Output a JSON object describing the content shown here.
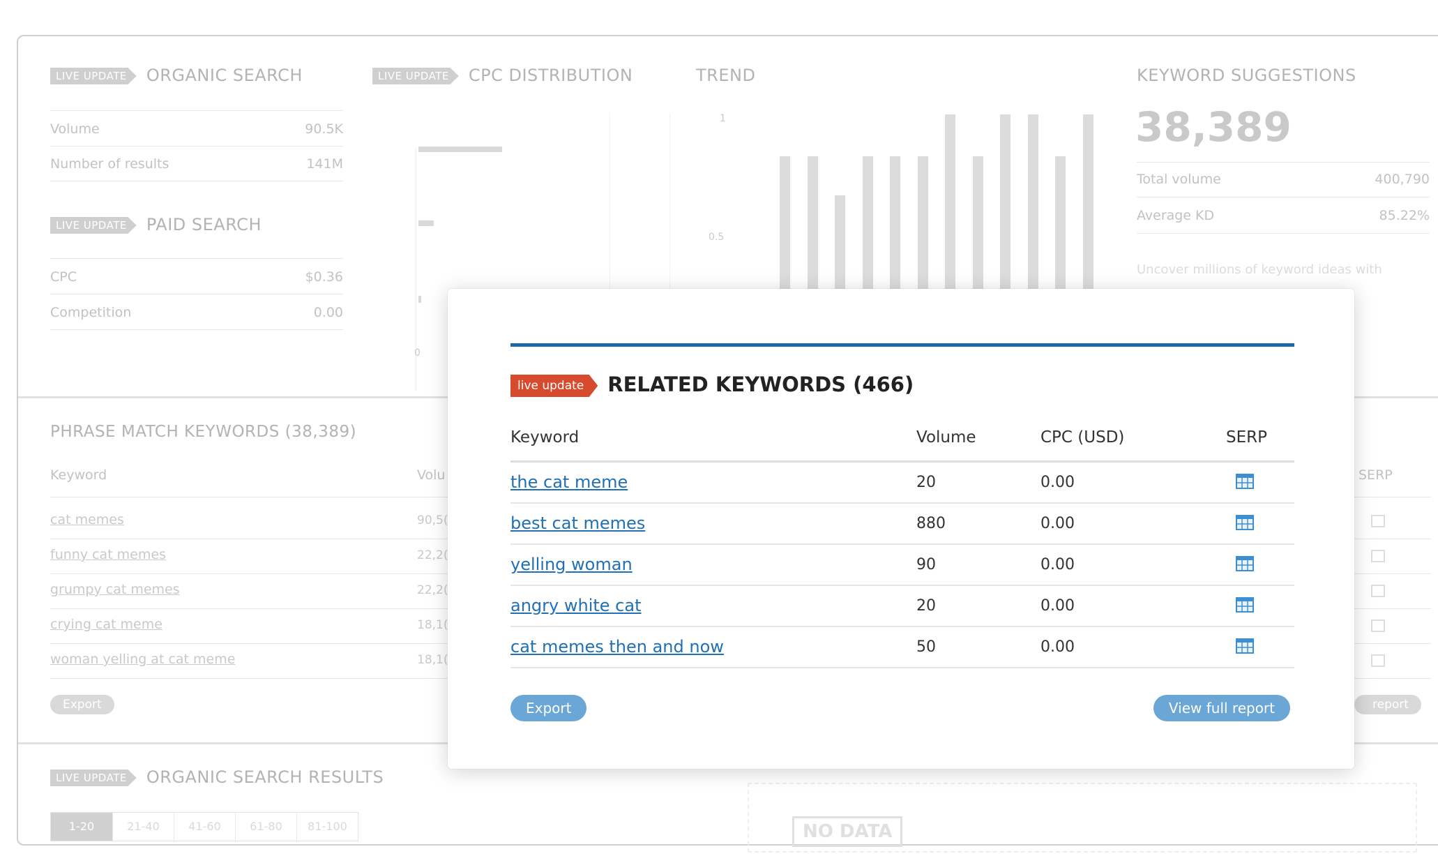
{
  "background": {
    "tag": "live update",
    "organic_search": {
      "title": "ORGANIC SEARCH",
      "rows": [
        {
          "label": "Volume",
          "value": "90.5K"
        },
        {
          "label": "Number of results",
          "value": "141M"
        }
      ]
    },
    "paid_search": {
      "title": "PAID SEARCH",
      "rows": [
        {
          "label": "CPC",
          "value": "$0.36"
        },
        {
          "label": "Competition",
          "value": "0.00"
        }
      ]
    },
    "cpc_distribution": {
      "title": "CPC DISTRIBUTION",
      "y_ticks": [
        "0"
      ]
    },
    "trend": {
      "title": "TREND",
      "y_ticks": [
        "1",
        "0.5"
      ],
      "values": [
        0.76,
        0.76,
        0.54,
        0.76,
        0.76,
        0.76,
        1.0,
        0.76,
        1.0,
        1.0,
        0.76,
        1.0
      ]
    },
    "keyword_suggestions": {
      "title": "KEYWORD SUGGESTIONS",
      "count": "38,389",
      "rows": [
        {
          "label": "Total volume",
          "value": "400,790"
        },
        {
          "label": "Average KD",
          "value": "85.22%"
        }
      ],
      "note": "Uncover millions of keyword ideas with"
    },
    "phrase_match": {
      "title": "PHRASE MATCH KEYWORDS (38,389)",
      "col_keyword": "Keyword",
      "col_volume": "Volu",
      "col_serp": "SERP",
      "rows": [
        {
          "keyword": "cat memes",
          "volume": "90,5("
        },
        {
          "keyword": "funny cat memes",
          "volume": "22,2("
        },
        {
          "keyword": "grumpy cat memes",
          "volume": "22,2("
        },
        {
          "keyword": "crying cat meme",
          "volume": "18,1("
        },
        {
          "keyword": "woman yelling at cat meme",
          "volume": "18,1("
        }
      ],
      "export": "Export",
      "report": "report"
    },
    "organic_results": {
      "title": "ORGANIC SEARCH RESULTS",
      "pages": [
        "1-20",
        "21-40",
        "41-60",
        "61-80",
        "81-100"
      ],
      "no_data": "NO DATA"
    }
  },
  "modal": {
    "tag": "live update",
    "title": "RELATED KEYWORDS (466)",
    "columns": {
      "keyword": "Keyword",
      "volume": "Volume",
      "cpc": "CPC (USD)",
      "serp": "SERP"
    },
    "rows": [
      {
        "keyword": "the cat meme",
        "volume": "20",
        "cpc": "0.00"
      },
      {
        "keyword": "best cat memes",
        "volume": "880",
        "cpc": "0.00"
      },
      {
        "keyword": "yelling woman",
        "volume": "90",
        "cpc": "0.00"
      },
      {
        "keyword": "angry white cat",
        "volume": "20",
        "cpc": "0.00"
      },
      {
        "keyword": "cat memes then and now",
        "volume": "50",
        "cpc": "0.00"
      }
    ],
    "export_label": "Export",
    "full_report_label": "View full report",
    "accent_color": "#1b69a8",
    "tag_color": "#d64a2d",
    "link_color": "#2170b5"
  }
}
